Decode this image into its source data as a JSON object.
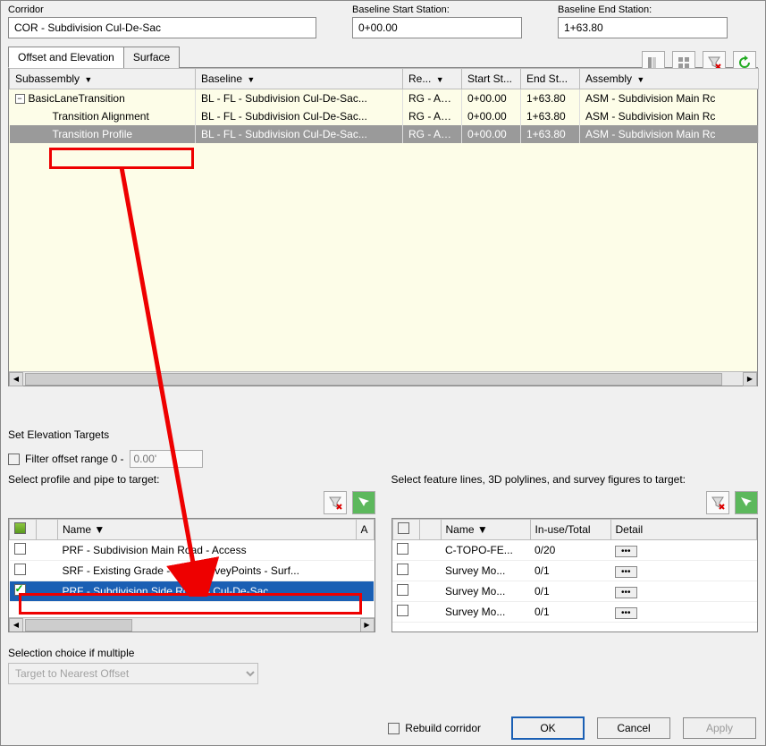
{
  "top": {
    "corridor_label": "Corridor",
    "corridor_value": "COR - Subdivision Cul-De-Sac",
    "start_label": "Baseline Start Station:",
    "start_value": "0+00.00",
    "end_label": "Baseline End Station:",
    "end_value": "1+63.80"
  },
  "tabs": {
    "t1": "Offset and Elevation",
    "t2": "Surface"
  },
  "grid": {
    "headers": {
      "sub": "Subassembly",
      "base": "Baseline",
      "reg": "Re...",
      "ss": "Start St...",
      "es": "End St...",
      "asm": "Assembly"
    },
    "root": "BasicLaneTransition",
    "child1": "Transition Alignment",
    "child2": "Transition Profile",
    "rows": [
      {
        "base": "BL - FL - Subdivision Cul-De-Sac...",
        "reg": "RG - AS...",
        "ss": "0+00.00",
        "es": "1+63.80",
        "asm": "ASM - Subdivision Main Rc"
      },
      {
        "base": "BL - FL - Subdivision Cul-De-Sac...",
        "reg": "RG - AS...",
        "ss": "0+00.00",
        "es": "1+63.80",
        "asm": "ASM - Subdivision Main Rc"
      },
      {
        "base": "BL - FL - Subdivision Cul-De-Sac...",
        "reg": "RG - AS...",
        "ss": "0+00.00",
        "es": "1+63.80",
        "asm": "ASM - Subdivision Main Rc"
      }
    ]
  },
  "bottom": {
    "title": "Set Elevation Targets",
    "filter_label": "Filter offset range   0 -",
    "filter_placeholder": "0.00'",
    "left_label": "Select profile and pipe to target:",
    "right_label": "Select feature lines, 3D polylines, and survey figures to target:",
    "list_headers": {
      "name": "Name",
      "a": "A",
      "inuse": "In-use/Total",
      "detail": "Detail"
    },
    "left_items": [
      {
        "name": "PRF - Subdivision Main Road - Access",
        "checked": false
      },
      {
        "name": "SRF - Existing Grade - FromSurveyPoints - Surf...",
        "checked": false
      },
      {
        "name": "PRF - Subdivision Side Road – Cul-De-Sac",
        "checked": true
      }
    ],
    "right_items": [
      {
        "name": "C-TOPO-FE...",
        "inuse": "0/20"
      },
      {
        "name": "Survey Mo...",
        "inuse": "0/1"
      },
      {
        "name": "Survey Mo...",
        "inuse": "0/1"
      },
      {
        "name": "Survey Mo...",
        "inuse": "0/1"
      }
    ],
    "choice_label": "Selection choice if multiple",
    "choice_value": "Target to Nearest Offset"
  },
  "footer": {
    "rebuild": "Rebuild corridor",
    "ok": "OK",
    "cancel": "Cancel",
    "apply": "Apply"
  },
  "detail_btn": "•••"
}
